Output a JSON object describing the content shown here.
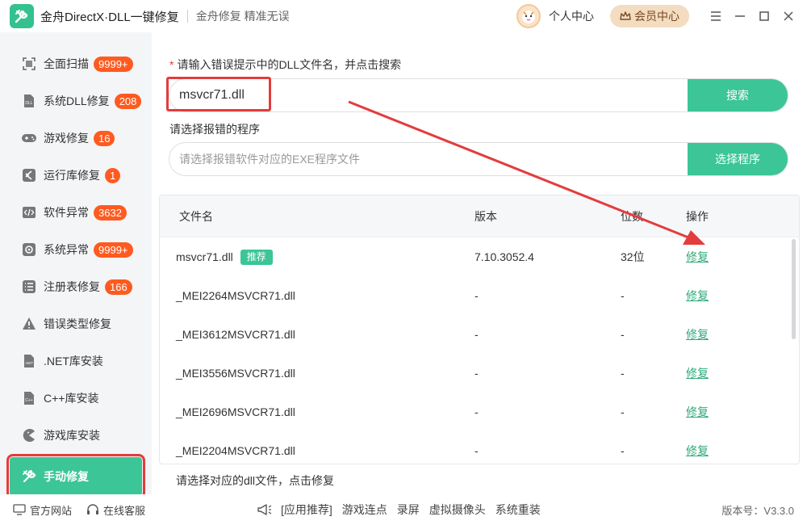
{
  "app": {
    "title": "金舟DirectX·DLL一键修复",
    "slogan": "金舟修复 精准无误",
    "personal_center": "个人中心",
    "vip": "会员中心"
  },
  "sidebar": {
    "items": [
      {
        "label": "全面扫描",
        "badge": "9999+",
        "icon": "scan-icon"
      },
      {
        "label": "系统DLL修复",
        "badge": "208",
        "icon": "dll-icon"
      },
      {
        "label": "游戏修复",
        "badge": "16",
        "icon": "gamepad-icon"
      },
      {
        "label": "运行库修复",
        "badge": "1",
        "icon": "vs-icon"
      },
      {
        "label": "软件异常",
        "badge": "3632",
        "icon": "code-icon"
      },
      {
        "label": "系统异常",
        "badge": "9999+",
        "icon": "gear-icon"
      },
      {
        "label": "注册表修复",
        "badge": "166",
        "icon": "list-icon"
      },
      {
        "label": "错误类型修复",
        "badge": "",
        "icon": "warning-icon"
      },
      {
        "label": ".NET库安装",
        "badge": "",
        "icon": "dotnet-icon"
      },
      {
        "label": "C++库安装",
        "badge": "",
        "icon": "cpp-icon"
      },
      {
        "label": "游戏库安装",
        "badge": "",
        "icon": "pacman-icon"
      },
      {
        "label": "手动修复",
        "badge": "",
        "icon": "tools-icon"
      }
    ],
    "active_index": 11
  },
  "search": {
    "required_mark": "*",
    "label": "请输入错误提示中的DLL文件名，并点击搜索",
    "value": "msvcr71.dll",
    "button": "搜索"
  },
  "program": {
    "label": "请选择报错的程序",
    "placeholder": "请选择报错软件对应的EXE程序文件",
    "button": "选择程序"
  },
  "table": {
    "headers": {
      "name": "文件名",
      "version": "版本",
      "bits": "位数",
      "op": "操作"
    },
    "rows": [
      {
        "name": "msvcr71.dll",
        "badge": "推荐",
        "version": "7.10.3052.4",
        "bits": "32位",
        "op": "修复"
      },
      {
        "name": "_MEI2264MSVCR71.dll",
        "badge": "",
        "version": "-",
        "bits": "-",
        "op": "修复"
      },
      {
        "name": "_MEI3612MSVCR71.dll",
        "badge": "",
        "version": "-",
        "bits": "-",
        "op": "修复"
      },
      {
        "name": "_MEI3556MSVCR71.dll",
        "badge": "",
        "version": "-",
        "bits": "-",
        "op": "修复"
      },
      {
        "name": "_MEI2696MSVCR71.dll",
        "badge": "",
        "version": "-",
        "bits": "-",
        "op": "修复"
      },
      {
        "name": "_MEI2204MSVCR71.dll",
        "badge": "",
        "version": "-",
        "bits": "-",
        "op": "修复"
      }
    ]
  },
  "hint": "请选择对应的dll文件，点击修复",
  "footer": {
    "website": "官方网站",
    "service": "在线客服",
    "links": [
      "[应用推荐]",
      "游戏连点",
      "录屏",
      "虚拟摄像头",
      "系统重装"
    ],
    "version": "版本号：V3.3.0"
  },
  "colors": {
    "accent": "#3cc597",
    "badge": "#ff5a1f",
    "annotation": "#e33c3c"
  }
}
